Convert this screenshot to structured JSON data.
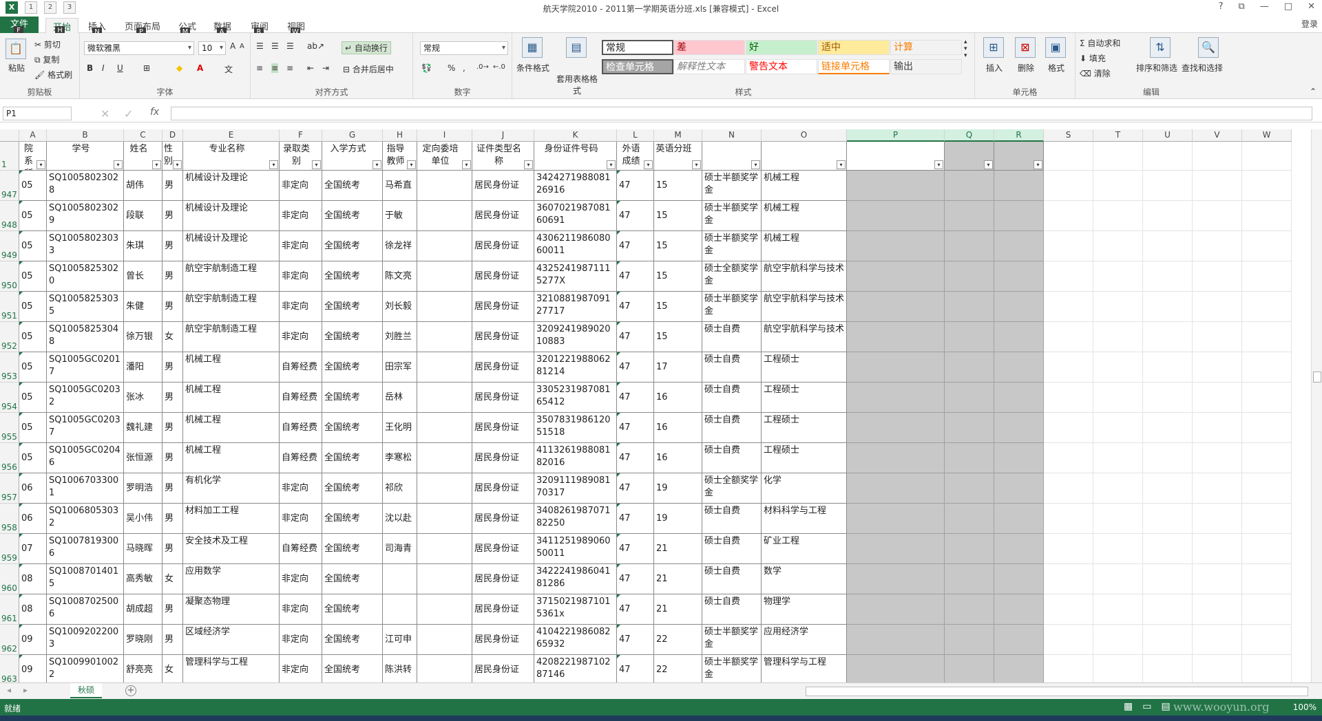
{
  "window": {
    "title": "航天学院2010 - 2011第一学期英语分班.xls  [兼容模式] - Excel",
    "login": "登录",
    "qat_keytips": [
      "1",
      "2",
      "3"
    ],
    "controls": [
      "?",
      "⧉",
      "—",
      "□",
      "✕"
    ]
  },
  "tabs": [
    {
      "label": "文件",
      "key": "F"
    },
    {
      "label": "开始",
      "key": "H"
    },
    {
      "label": "插入",
      "key": "N"
    },
    {
      "label": "页面布局",
      "key": "P"
    },
    {
      "label": "公式",
      "key": "M"
    },
    {
      "label": "数据",
      "key": "A"
    },
    {
      "label": "审阅",
      "key": "R"
    },
    {
      "label": "视图",
      "key": "W"
    }
  ],
  "ribbon": {
    "clipboard": {
      "label": "剪贴板",
      "paste": "粘贴",
      "cut": "剪切",
      "copy": "复制",
      "format_painter": "格式刷"
    },
    "font": {
      "label": "字体",
      "name": "微软雅黑",
      "size": "10",
      "bold": "B",
      "italic": "I",
      "underline": "U"
    },
    "alignment": {
      "label": "对齐方式",
      "wrap": "自动换行",
      "merge": "合并后居中"
    },
    "number": {
      "label": "数字",
      "format": "常规",
      "percent": "%",
      "comma": ","
    },
    "styles": {
      "label": "样式",
      "cond_format": "条件格式",
      "table_format": "套用表格格式",
      "items": [
        {
          "text": "常规",
          "bg": "#ffffff",
          "fg": "#222222"
        },
        {
          "text": "差",
          "bg": "#ffc7ce",
          "fg": "#9c0006"
        },
        {
          "text": "好",
          "bg": "#c6efce",
          "fg": "#006100"
        },
        {
          "text": "适中",
          "bg": "#ffeb9c",
          "fg": "#9c5700"
        },
        {
          "text": "计算",
          "bg": "#f2f2f2",
          "fg": "#fa7d00"
        },
        {
          "text": "检查单元格",
          "bg": "#a5a5a5",
          "fg": "#ffffff"
        },
        {
          "text": "解释性文本",
          "bg": "#ffffff",
          "fg": "#7f7f7f"
        },
        {
          "text": "警告文本",
          "bg": "#ffffff",
          "fg": "#ff0000"
        },
        {
          "text": "链接单元格",
          "bg": "#ffffff",
          "fg": "#fa7d00"
        },
        {
          "text": "输出",
          "bg": "#f2f2f2",
          "fg": "#3f3f3f"
        }
      ]
    },
    "cells": {
      "label": "单元格",
      "insert": "插入",
      "delete": "删除",
      "format": "格式"
    },
    "editing": {
      "label": "编辑",
      "autosum": "自动求和",
      "fill": "填充",
      "clear": "清除",
      "sort": "排序和筛选",
      "find": "查找和选择"
    }
  },
  "formula_bar": {
    "name_box": "P1",
    "fx": "fx",
    "value": ""
  },
  "grid": {
    "columns": [
      "A",
      "B",
      "C",
      "D",
      "E",
      "F",
      "G",
      "H",
      "I",
      "J",
      "K",
      "L",
      "M",
      "N",
      "O",
      "P",
      "Q",
      "R",
      "S",
      "T",
      "U",
      "V",
      "W"
    ],
    "selected_columns": [
      "P",
      "Q",
      "R"
    ],
    "header_row_number": "1",
    "headers": [
      "院系所代",
      "学号",
      "姓名",
      "性别",
      "专业名称",
      "录取类别",
      "入学方式",
      "指导教师",
      "定向委培单位",
      "证件类型名称",
      "身份证件号码",
      "外语成绩",
      "英语分班",
      "",
      "",
      "",
      "",
      ""
    ],
    "rows": [
      {
        "n": "947",
        "c": [
          "05",
          "SQ10058023028",
          "胡伟",
          "男",
          "机械设计及理论",
          "非定向",
          "全国统考",
          "马希直",
          "",
          "居民身份证",
          "342427198808126916",
          "47",
          "15",
          "硕士半额奖学金",
          "机械工程"
        ]
      },
      {
        "n": "948",
        "c": [
          "05",
          "SQ10058023029",
          "段联",
          "男",
          "机械设计及理论",
          "非定向",
          "全国统考",
          "于敏",
          "",
          "居民身份证",
          "360702198708160691",
          "47",
          "15",
          "硕士半额奖学金",
          "机械工程"
        ]
      },
      {
        "n": "949",
        "c": [
          "05",
          "SQ10058023033",
          "朱琪",
          "男",
          "机械设计及理论",
          "非定向",
          "全国统考",
          "徐龙祥",
          "",
          "居民身份证",
          "430621198608060011",
          "47",
          "15",
          "硕士半额奖学金",
          "机械工程"
        ]
      },
      {
        "n": "950",
        "c": [
          "05",
          "SQ10058253020",
          "曾长",
          "男",
          "航空宇航制造工程",
          "非定向",
          "全国统考",
          "陈文亮",
          "",
          "居民身份证",
          "43252419871115277X",
          "47",
          "15",
          "硕士全额奖学金",
          "航空宇航科学与技术"
        ]
      },
      {
        "n": "951",
        "c": [
          "05",
          "SQ10058253035",
          "朱健",
          "男",
          "航空宇航制造工程",
          "非定向",
          "全国统考",
          "刘长毅",
          "",
          "居民身份证",
          "321088198709127717",
          "47",
          "15",
          "硕士半额奖学金",
          "航空宇航科学与技术"
        ]
      },
      {
        "n": "952",
        "c": [
          "05",
          "SQ10058253048",
          "徐万银",
          "女",
          "航空宇航制造工程",
          "非定向",
          "全国统考",
          "刘胜兰",
          "",
          "居民身份证",
          "320924198902010883",
          "47",
          "15",
          "硕士自费",
          "航空宇航科学与技术"
        ]
      },
      {
        "n": "953",
        "c": [
          "05",
          "SQ1005GC02017",
          "潘阳",
          "男",
          "机械工程",
          "自筹经费",
          "全国统考",
          "田宗军",
          "",
          "居民身份证",
          "320122198806281214",
          "47",
          "17",
          "硕士自费",
          "工程硕士"
        ]
      },
      {
        "n": "954",
        "c": [
          "05",
          "SQ1005GC02032",
          "张冰",
          "男",
          "机械工程",
          "自筹经费",
          "全国统考",
          "岳林",
          "",
          "居民身份证",
          "330523198708165412",
          "47",
          "16",
          "硕士自费",
          "工程硕士"
        ]
      },
      {
        "n": "955",
        "c": [
          "05",
          "SQ1005GC02037",
          "魏礼建",
          "男",
          "机械工程",
          "自筹经费",
          "全国统考",
          "王化明",
          "",
          "居民身份证",
          "350783198612051518",
          "47",
          "16",
          "硕士自费",
          "工程硕士"
        ]
      },
      {
        "n": "956",
        "c": [
          "05",
          "SQ1005GC02046",
          "张恒源",
          "男",
          "机械工程",
          "自筹经费",
          "全国统考",
          "李寒松",
          "",
          "居民身份证",
          "411326198808182016",
          "47",
          "16",
          "硕士自费",
          "工程硕士"
        ]
      },
      {
        "n": "957",
        "c": [
          "06",
          "SQ10067033001",
          "罗明浩",
          "男",
          "有机化学",
          "非定向",
          "全国统考",
          "祁欣",
          "",
          "居民身份证",
          "320911198908170317",
          "47",
          "19",
          "硕士全额奖学金",
          "化学"
        ]
      },
      {
        "n": "958",
        "c": [
          "06",
          "SQ10068053032",
          "吴小伟",
          "男",
          "材料加工工程",
          "非定向",
          "全国统考",
          "沈以赴",
          "",
          "居民身份证",
          "340826198707182250",
          "47",
          "19",
          "硕士自费",
          "材料科学与工程"
        ]
      },
      {
        "n": "959",
        "c": [
          "07",
          "SQ10078193006",
          "马晓晖",
          "男",
          "安全技术及工程",
          "自筹经费",
          "全国统考",
          "司海青",
          "",
          "居民身份证",
          "341125198906050011",
          "47",
          "21",
          "硕士自费",
          "矿业工程"
        ]
      },
      {
        "n": "960",
        "c": [
          "08",
          "SQ10087014015",
          "高秀敏",
          "女",
          "应用数学",
          "非定向",
          "全国统考",
          "",
          "",
          "居民身份证",
          "342224198604181286",
          "47",
          "21",
          "硕士自费",
          "数学"
        ]
      },
      {
        "n": "961",
        "c": [
          "08",
          "SQ10087025006",
          "胡成超",
          "男",
          "凝聚态物理",
          "非定向",
          "全国统考",
          "",
          "",
          "居民身份证",
          "37150219871015361x",
          "47",
          "21",
          "硕士自费",
          "物理学"
        ]
      },
      {
        "n": "962",
        "c": [
          "09",
          "SQ10092022003",
          "罗晓刚",
          "男",
          "区域经济学",
          "非定向",
          "全国统考",
          "江可申",
          "",
          "居民身份证",
          "410422198608265932",
          "47",
          "22",
          "硕士半额奖学金",
          "应用经济学"
        ]
      },
      {
        "n": "963",
        "c": [
          "09",
          "SQ10099010022",
          "舒亮亮",
          "女",
          "管理科学与工程",
          "非定向",
          "全国统考",
          "陈洪转",
          "",
          "居民身份证",
          "420822198710287146",
          "47",
          "22",
          "硕士半额奖学金",
          "管理科学与工程"
        ]
      }
    ]
  },
  "sheet": {
    "tab": "秋硕",
    "add": "+"
  },
  "status": {
    "ready": "就绪",
    "zoom": "100%",
    "watermark": "www.wooyun.org"
  }
}
